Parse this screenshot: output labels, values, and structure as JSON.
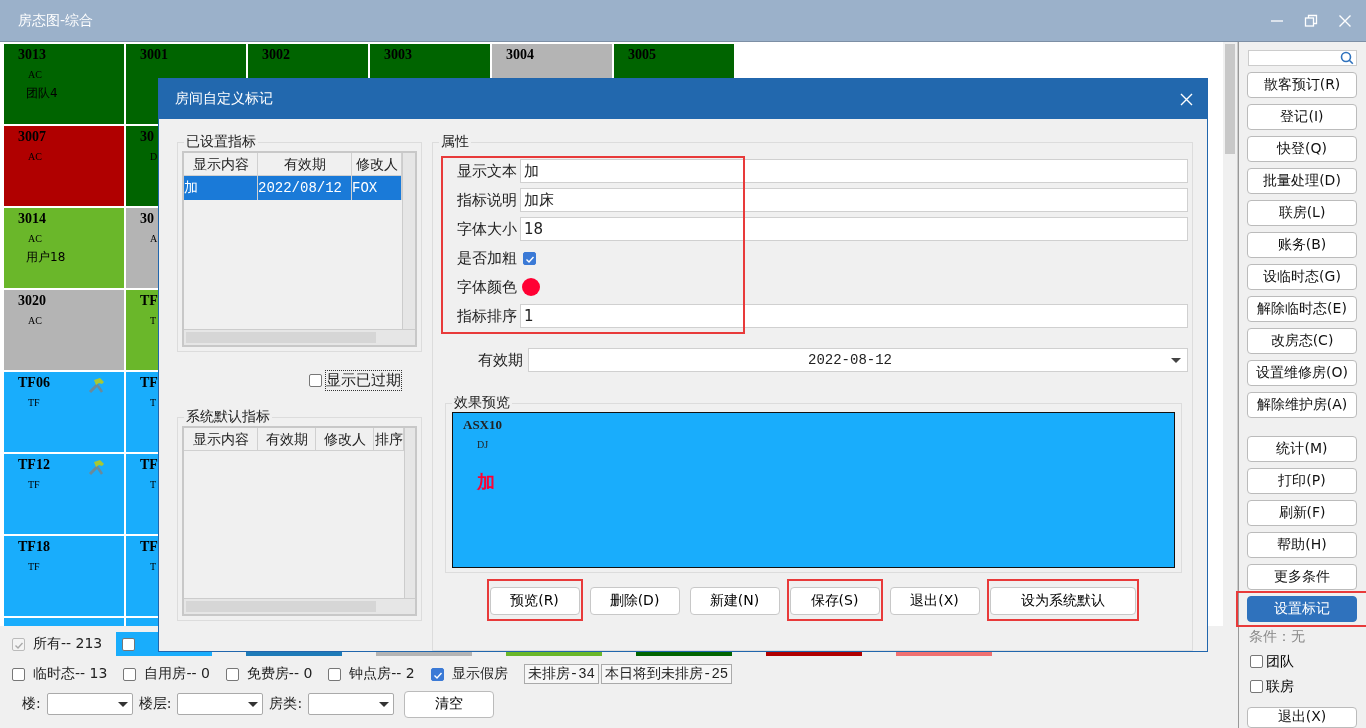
{
  "window": {
    "title": "房态图-综合"
  },
  "room_grid": {
    "rows": [
      [
        {
          "code": "3013",
          "type": "AC",
          "note": "团队4",
          "color": "#006400"
        },
        {
          "code": "3001",
          "color": "#006400"
        },
        {
          "code": "3002",
          "color": "#006400"
        },
        {
          "code": "3003",
          "color": "#006400"
        },
        {
          "code": "3004",
          "color": "#b4b4b4"
        },
        {
          "code": "3005",
          "color": "#006400"
        }
      ],
      [
        {
          "code": "3007",
          "type": "AC",
          "color": "#b00000"
        },
        {
          "code": "30",
          "type": "D",
          "color": "#006400"
        }
      ],
      [
        {
          "code": "3014",
          "type": "AC",
          "note": "用户18",
          "color": "#6ab72a"
        },
        {
          "code": "30",
          "type": "A",
          "color": "#b4b4b4"
        }
      ],
      [
        {
          "code": "3020",
          "type": "AC",
          "color": "#b4b4b4"
        },
        {
          "code": "TF",
          "type": "T",
          "color": "#6ab72a"
        }
      ],
      [
        {
          "code": "TF06",
          "type": "TF",
          "kind": "maintenance",
          "color": "#19adfc"
        },
        {
          "code": "TF",
          "type": "T",
          "color": "#19adfc"
        }
      ],
      [
        {
          "code": "TF12",
          "type": "TF",
          "kind": "maintenance",
          "color": "#19adfc"
        },
        {
          "code": "TF",
          "type": "T",
          "color": "#19adfc"
        }
      ],
      [
        {
          "code": "TF18",
          "type": "TF",
          "color": "#19adfc"
        },
        {
          "code": "TF",
          "type": "T",
          "color": "#19adfc"
        }
      ],
      [
        {
          "color": "#19adfc"
        },
        {
          "color": "#19adfc"
        }
      ]
    ]
  },
  "footer": {
    "legend": [
      {
        "kind": "count",
        "label": "所有-- 213",
        "checked": true,
        "disabled": true
      },
      {
        "kind": "swatch",
        "color": "#19adfc",
        "checked": false
      },
      {
        "kind": "strip",
        "color": "#1e7bb8"
      },
      {
        "kind": "strip",
        "color": "#b4b4b4"
      },
      {
        "kind": "strip",
        "color": "#6ab72a"
      },
      {
        "kind": "strip",
        "color": "#006400"
      },
      {
        "kind": "strip",
        "color": "#b00000"
      },
      {
        "kind": "strip",
        "color": "#f07070"
      }
    ],
    "filters": [
      {
        "label": "临时态-- 13",
        "checked": false
      },
      {
        "label": "自用房-- 0",
        "checked": false
      },
      {
        "label": "免费房-- 0",
        "checked": false
      },
      {
        "label": "钟点房-- 2",
        "checked": false
      },
      {
        "label": "显示假房",
        "checked": true
      }
    ],
    "counters": [
      "未排房-34",
      "本日将到未排房-25"
    ],
    "selects": [
      {
        "label": "楼:"
      },
      {
        "label": "楼层:"
      },
      {
        "label": "房类:"
      }
    ],
    "clear_button": "清空"
  },
  "sidebar": {
    "groups": [
      [
        {
          "label": "散客预订(R)",
          "selected": false
        },
        {
          "label": "登记(I)",
          "selected": false
        },
        {
          "label": "快登(Q)",
          "selected": false
        },
        {
          "label": "批量处理(D)",
          "selected": false
        },
        {
          "label": "联房(L)",
          "selected": false
        },
        {
          "label": "账务(B)",
          "selected": false
        },
        {
          "label": "设临时态(G)",
          "selected": false
        },
        {
          "label": "解除临时态(E)",
          "selected": false
        },
        {
          "label": "改房态(C)",
          "selected": false
        },
        {
          "label": "设置维修房(O)",
          "selected": false
        },
        {
          "label": "解除维护房(A)",
          "selected": false
        }
      ],
      [
        {
          "label": "统计(M)",
          "selected": false
        },
        {
          "label": "打印(P)",
          "selected": false
        },
        {
          "label": "刷新(F)",
          "selected": false
        },
        {
          "label": "帮助(H)",
          "selected": false
        },
        {
          "label": "更多条件",
          "selected": false
        },
        {
          "label": "设置标记",
          "selected": true,
          "highlighted": true
        }
      ]
    ],
    "condition": "条件：无",
    "checkboxes": [
      {
        "label": "团队",
        "checked": false
      },
      {
        "label": "联房",
        "checked": false
      }
    ],
    "exit_button": "退出(X)"
  },
  "dialog": {
    "title": "房间自定义标记",
    "set_markers": {
      "title": "已设置指标",
      "columns": [
        "显示内容",
        "有效期",
        "修改人"
      ],
      "rows": [
        {
          "cells": [
            "加",
            "2022/08/12",
            "FOX"
          ],
          "selected": true
        }
      ]
    },
    "show_expired": {
      "label": "显示已过期",
      "checked": false
    },
    "default_markers": {
      "title": "系统默认指标",
      "columns": [
        "显示内容",
        "有效期",
        "修改人",
        "排序"
      ]
    },
    "properties": {
      "title": "属性",
      "highlighted": true,
      "fields": [
        {
          "label": "显示文本",
          "kind": "text",
          "value": "加"
        },
        {
          "label": "指标说明",
          "kind": "text",
          "value": "加床"
        },
        {
          "label": "字体大小",
          "kind": "text",
          "value": "18"
        },
        {
          "label": "是否加粗",
          "kind": "checkbox",
          "checked": true
        },
        {
          "label": "字体颜色",
          "kind": "color",
          "color": "#ff0033"
        },
        {
          "label": "指标排序",
          "kind": "text",
          "value": "1"
        }
      ],
      "validity": {
        "label": "有效期",
        "value": "2022-08-12"
      }
    },
    "preview": {
      "title": "效果预览",
      "room": "ASX10",
      "type": "DJ",
      "mark": "加"
    },
    "buttons": [
      {
        "label": "预览(R)",
        "highlighted": true
      },
      {
        "label": "删除(D)",
        "highlighted": false
      },
      {
        "label": "新建(N)",
        "highlighted": false
      },
      {
        "label": "保存(S)",
        "highlighted": true
      },
      {
        "label": "退出(X)",
        "highlighted": false
      },
      {
        "label": "设为系统默认",
        "highlighted": true
      }
    ]
  }
}
